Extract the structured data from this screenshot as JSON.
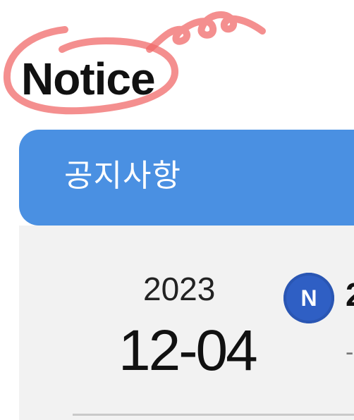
{
  "page": {
    "heading": "Notice"
  },
  "notice_board": {
    "title": "공지사항",
    "items": [
      {
        "year": "2023",
        "month_day": "12-04",
        "badge": "N",
        "title_fragment": "2",
        "subtitle_fragment": "-"
      }
    ]
  },
  "colors": {
    "header_bg": "#4a90e2",
    "panel_bg": "#f2f2f2",
    "badge_bg": "#2f5fc4",
    "scribble": "#f06a6a"
  },
  "icons": {
    "badge": "new-badge-icon"
  }
}
